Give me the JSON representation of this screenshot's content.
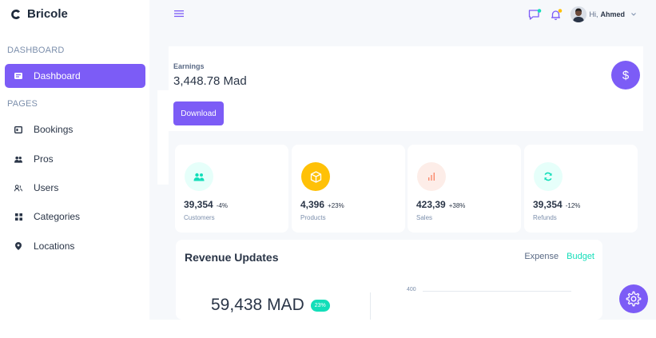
{
  "brand": {
    "name": "Bricole",
    "accent": "#7c5cf6"
  },
  "sidebar": {
    "dashboard_section": "DASHBOARD",
    "pages_section": "PAGES",
    "active_item": {
      "label": "Dashboard",
      "icon": "dashboard-icon"
    },
    "items": [
      {
        "label": "Bookings",
        "icon": "bookings-icon"
      },
      {
        "label": "Pros",
        "icon": "pros-icon"
      },
      {
        "label": "Users",
        "icon": "users-icon"
      },
      {
        "label": "Categories",
        "icon": "categories-icon"
      },
      {
        "label": "Locations",
        "icon": "location-pin-icon"
      }
    ]
  },
  "header": {
    "greeting": "Hi,",
    "user_name": "Ahmed"
  },
  "earnings": {
    "label": "Earnings",
    "value": "3,448.78 Mad",
    "download_label": "Download",
    "currency_icon": "$"
  },
  "stats": [
    {
      "value": "39,354",
      "change": "-4%",
      "label": "Customers",
      "icon": "customers-icon",
      "color": "#13deb9",
      "bg": "#e6fffa"
    },
    {
      "value": "4,396",
      "change": "+23%",
      "label": "Products",
      "icon": "box-icon",
      "color": "#ffffff",
      "bg": "#ffc107"
    },
    {
      "value": "423,39",
      "change": "+38%",
      "label": "Sales",
      "icon": "bar-chart-icon",
      "color": "#fa896b",
      "bg": "#fdede8"
    },
    {
      "value": "39,354",
      "change": "-12%",
      "label": "Refunds",
      "icon": "refresh-icon",
      "color": "#13deb9",
      "bg": "#e6fffa"
    }
  ],
  "revenue": {
    "title": "Revenue Updates",
    "legend_expense": "Expense",
    "legend_budget": "Budget",
    "total": "59,438 MAD",
    "badge": "23%",
    "axis_tick": "400"
  }
}
